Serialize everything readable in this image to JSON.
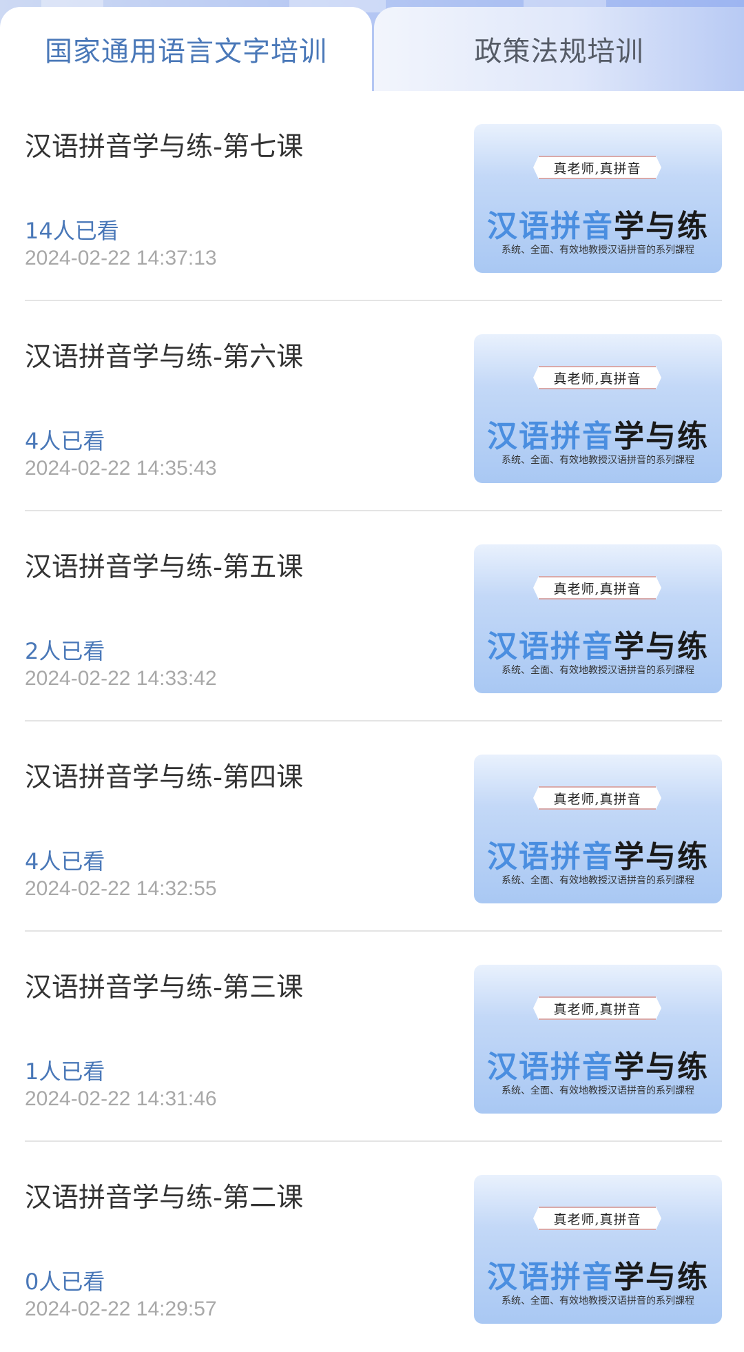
{
  "tabs": [
    {
      "label": "国家通用语言文字培训",
      "active": true
    },
    {
      "label": "政策法规培训",
      "active": false
    }
  ],
  "thumbnail": {
    "ribbon": "真老师,真拼音",
    "headline_blue": "汉语拼音",
    "headline_dark": "学与练",
    "subtitle": "系统、全面、有效地教授汉语拼音的系列課程"
  },
  "colors": {
    "accent": "#4a78b8",
    "date_gray": "#a8a8a8",
    "title": "#333333"
  },
  "items": [
    {
      "title": "汉语拼音学与练-第七课",
      "views": "14人已看",
      "date": "2024-02-22 14:37:13"
    },
    {
      "title": "汉语拼音学与练-第六课",
      "views": "4人已看",
      "date": "2024-02-22 14:35:43"
    },
    {
      "title": "汉语拼音学与练-第五课",
      "views": "2人已看",
      "date": "2024-02-22 14:33:42"
    },
    {
      "title": "汉语拼音学与练-第四课",
      "views": "4人已看",
      "date": "2024-02-22 14:32:55"
    },
    {
      "title": "汉语拼音学与练-第三课",
      "views": "1人已看",
      "date": "2024-02-22 14:31:46"
    },
    {
      "title": "汉语拼音学与练-第二课",
      "views": "0人已看",
      "date": "2024-02-22 14:29:57"
    }
  ]
}
